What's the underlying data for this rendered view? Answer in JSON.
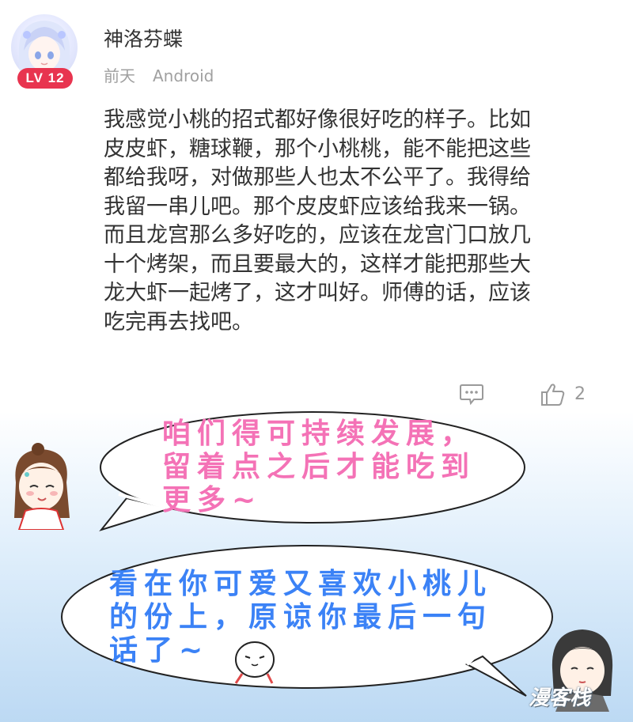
{
  "comment": {
    "username": "神洛芬蝶",
    "level_badge": "LV 12",
    "time": "前天",
    "device": "Android",
    "content": "我感觉小桃的招式都好像很好吃的样子。比如\n皮皮虾，糖球鞭，那个小桃桃，能不能把这些\n都给我呀，对做那些人也太不公平了。我得给\n我留一串儿吧。那个皮皮虾应该给我来一锅。\n而且龙宫那么多好吃的，应该在龙宫门口放几\n十个烤架，而且要最大的，这样才能把那些大\n龙大虾一起烤了，这才叫好。师傅的话，应该\n吃完再去找吧。",
    "like_count": "2"
  },
  "bubbles": [
    {
      "text": "咱们得可持续发展，\n留着点之后才能吃到\n更多~",
      "color": "#f472b6"
    },
    {
      "text": "看在你可爱又喜欢小桃儿\n的份上，原谅你最后一句\n话了~",
      "color": "#3b82f6"
    }
  ],
  "icons": [
    "avatar",
    "reply-icon",
    "like-icon"
  ],
  "colors": {
    "badge": "#e8344f",
    "meta": "#a0a0a0",
    "text": "#333333"
  }
}
